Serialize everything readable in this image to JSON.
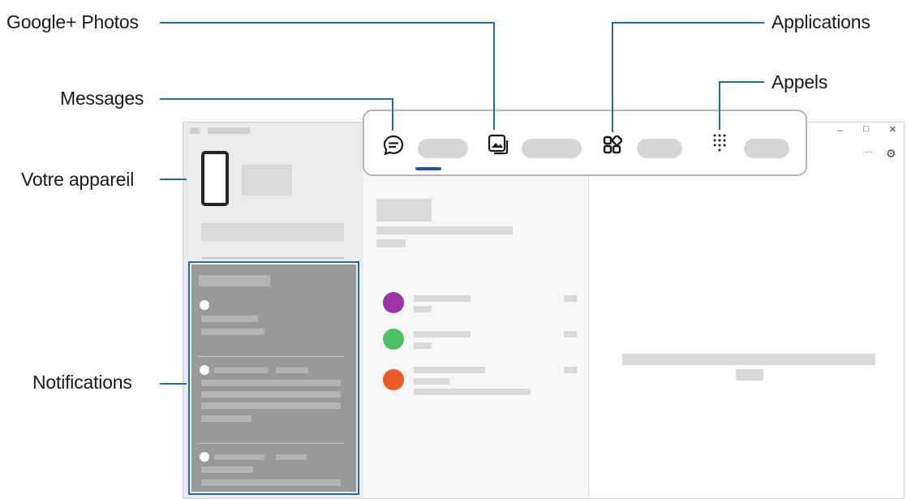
{
  "callouts": {
    "google_photos": "Google+ Photos",
    "messages": "Messages",
    "device": "Votre appareil",
    "notifications": "Notifications",
    "applications": "Applications",
    "calls": "Appels"
  },
  "icons": {
    "messages": "chat-bubble-icon",
    "photos": "gallery-icon",
    "apps": "apps-grid-icon",
    "calls": "dialpad-icon",
    "settings": "gear-icon",
    "more": "more-icon",
    "minimize": "minimize-icon",
    "maximize": "maximize-icon",
    "close": "close-icon"
  },
  "window_controls": {
    "minimize": "–",
    "maximize": "□",
    "close": "×",
    "more": "···",
    "settings": "⚙"
  },
  "colors": {
    "accent": "#1f6f9a",
    "tab_indicator": "#2455b0",
    "avatar_1": "#9b35a5",
    "avatar_2": "#4cc266",
    "avatar_3": "#ea5a24"
  }
}
